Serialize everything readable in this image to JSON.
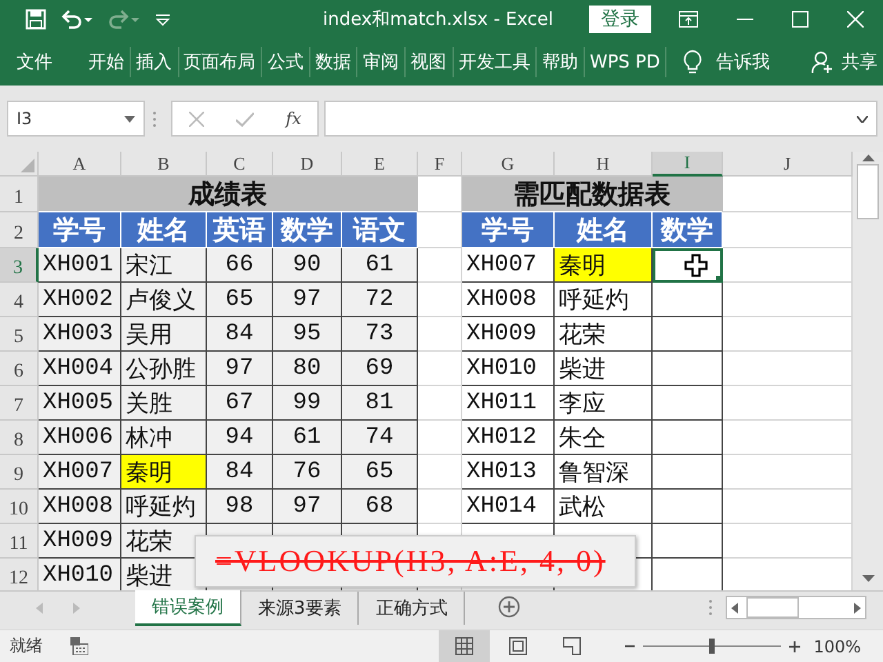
{
  "window": {
    "title": "index和match.xlsx  -  Excel",
    "login": "登录"
  },
  "ribbon": {
    "tabs": [
      "文件",
      "开始",
      "插入",
      "页面布局",
      "公式",
      "数据",
      "审阅",
      "视图",
      "开发工具",
      "帮助",
      "WPS PD"
    ],
    "tell_me": "告诉我",
    "share": "共享"
  },
  "formula_bar": {
    "name_box": "I3",
    "fx": "fx"
  },
  "sheet": {
    "columns": [
      {
        "label": "A",
        "selected": false
      },
      {
        "label": "B",
        "selected": false
      },
      {
        "label": "C",
        "selected": false
      },
      {
        "label": "D",
        "selected": false
      },
      {
        "label": "E",
        "selected": false
      },
      {
        "label": "F",
        "selected": false
      },
      {
        "label": "G",
        "selected": false
      },
      {
        "label": "H",
        "selected": false
      },
      {
        "label": "I",
        "selected": true
      },
      {
        "label": "J",
        "selected": false
      }
    ],
    "rows": [
      {
        "number": "1",
        "selected": false,
        "cells": [
          {
            "kind": "title"
          },
          {
            "kind": "title"
          },
          {
            "kind": "title",
            "text": "成绩表"
          },
          {
            "kind": "title"
          },
          {
            "kind": "title"
          },
          {
            "kind": "blank"
          },
          {
            "kind": "title"
          },
          {
            "kind": "title",
            "text": "需匹配数据表"
          },
          {
            "kind": "title"
          },
          {
            "kind": "blank"
          }
        ]
      },
      {
        "number": "2",
        "selected": false,
        "cells": [
          {
            "kind": "header",
            "text": "学号"
          },
          {
            "kind": "header",
            "text": "姓名"
          },
          {
            "kind": "header",
            "text": "英语"
          },
          {
            "kind": "header",
            "text": "数学"
          },
          {
            "kind": "header",
            "text": "语文"
          },
          {
            "kind": "blank"
          },
          {
            "kind": "header",
            "text": "学号"
          },
          {
            "kind": "header",
            "text": "姓名"
          },
          {
            "kind": "header",
            "text": "数学"
          },
          {
            "kind": "blank"
          }
        ]
      },
      {
        "number": "3",
        "selected": true,
        "cells": [
          {
            "kind": "text",
            "text": "XH001"
          },
          {
            "kind": "text",
            "text": "宋江"
          },
          {
            "kind": "number",
            "text": "66"
          },
          {
            "kind": "number",
            "text": "90"
          },
          {
            "kind": "number",
            "text": "61"
          },
          {
            "kind": "blank"
          },
          {
            "kind": "entry",
            "text": "XH007"
          },
          {
            "kind": "marked",
            "text": "秦明"
          },
          {
            "kind": "active"
          },
          {
            "kind": "blank"
          }
        ]
      },
      {
        "number": "4",
        "selected": false,
        "cells": [
          {
            "kind": "text",
            "text": "XH002"
          },
          {
            "kind": "text",
            "text": "卢俊义"
          },
          {
            "kind": "number",
            "text": "65"
          },
          {
            "kind": "number",
            "text": "97"
          },
          {
            "kind": "number",
            "text": "72"
          },
          {
            "kind": "blank"
          },
          {
            "kind": "entry",
            "text": "XH008"
          },
          {
            "kind": "entry",
            "text": "呼延灼"
          },
          {
            "kind": "entry"
          },
          {
            "kind": "blank"
          }
        ]
      },
      {
        "number": "5",
        "selected": false,
        "cells": [
          {
            "kind": "text",
            "text": "XH003"
          },
          {
            "kind": "text",
            "text": "吴用"
          },
          {
            "kind": "number",
            "text": "84"
          },
          {
            "kind": "number",
            "text": "95"
          },
          {
            "kind": "number",
            "text": "73"
          },
          {
            "kind": "blank"
          },
          {
            "kind": "entry",
            "text": "XH009"
          },
          {
            "kind": "entry",
            "text": "花荣"
          },
          {
            "kind": "entry"
          },
          {
            "kind": "blank"
          }
        ]
      },
      {
        "number": "6",
        "selected": false,
        "cells": [
          {
            "kind": "text",
            "text": "XH004"
          },
          {
            "kind": "text",
            "text": "公孙胜"
          },
          {
            "kind": "number",
            "text": "97"
          },
          {
            "kind": "number",
            "text": "80"
          },
          {
            "kind": "number",
            "text": "69"
          },
          {
            "kind": "blank"
          },
          {
            "kind": "entry",
            "text": "XH010"
          },
          {
            "kind": "entry",
            "text": "柴进"
          },
          {
            "kind": "entry"
          },
          {
            "kind": "blank"
          }
        ]
      },
      {
        "number": "7",
        "selected": false,
        "cells": [
          {
            "kind": "text",
            "text": "XH005"
          },
          {
            "kind": "text",
            "text": "关胜"
          },
          {
            "kind": "number",
            "text": "67"
          },
          {
            "kind": "number",
            "text": "99"
          },
          {
            "kind": "number",
            "text": "81"
          },
          {
            "kind": "blank"
          },
          {
            "kind": "entry",
            "text": "XH011"
          },
          {
            "kind": "entry",
            "text": "李应"
          },
          {
            "kind": "entry"
          },
          {
            "kind": "blank"
          }
        ]
      },
      {
        "number": "8",
        "selected": false,
        "cells": [
          {
            "kind": "text",
            "text": "XH006"
          },
          {
            "kind": "text",
            "text": "林冲"
          },
          {
            "kind": "number",
            "text": "94"
          },
          {
            "kind": "number",
            "text": "61"
          },
          {
            "kind": "number",
            "text": "74"
          },
          {
            "kind": "blank"
          },
          {
            "kind": "entry",
            "text": "XH012"
          },
          {
            "kind": "entry",
            "text": "朱仝"
          },
          {
            "kind": "entry"
          },
          {
            "kind": "blank"
          }
        ]
      },
      {
        "number": "9",
        "selected": false,
        "cells": [
          {
            "kind": "text",
            "text": "XH007"
          },
          {
            "kind": "marked",
            "text": "秦明"
          },
          {
            "kind": "number",
            "text": "84"
          },
          {
            "kind": "number",
            "text": "76"
          },
          {
            "kind": "number",
            "text": "65"
          },
          {
            "kind": "blank"
          },
          {
            "kind": "entry",
            "text": "XH013"
          },
          {
            "kind": "entry",
            "text": "鲁智深"
          },
          {
            "kind": "entry"
          },
          {
            "kind": "blank"
          }
        ]
      },
      {
        "number": "10",
        "selected": false,
        "cells": [
          {
            "kind": "text",
            "text": "XH008"
          },
          {
            "kind": "text",
            "text": "呼延灼"
          },
          {
            "kind": "number",
            "text": "98"
          },
          {
            "kind": "number",
            "text": "97"
          },
          {
            "kind": "number",
            "text": "68"
          },
          {
            "kind": "blank"
          },
          {
            "kind": "entry",
            "text": "XH014"
          },
          {
            "kind": "entry",
            "text": "武松"
          },
          {
            "kind": "entry"
          },
          {
            "kind": "blank"
          }
        ]
      },
      {
        "number": "11",
        "selected": false,
        "cells": [
          {
            "kind": "text",
            "text": "XH009"
          },
          {
            "kind": "text",
            "text": "花荣"
          },
          {
            "kind": "number"
          },
          {
            "kind": "number"
          },
          {
            "kind": "number"
          },
          {
            "kind": "blank"
          },
          {
            "kind": "entry"
          },
          {
            "kind": "entry"
          },
          {
            "kind": "entry"
          },
          {
            "kind": "blank"
          }
        ]
      },
      {
        "number": "12",
        "selected": false,
        "cells": [
          {
            "kind": "text",
            "text": "XH010"
          },
          {
            "kind": "text",
            "text": "柴进"
          },
          {
            "kind": "number"
          },
          {
            "kind": "number"
          },
          {
            "kind": "number"
          },
          {
            "kind": "blank"
          },
          {
            "kind": "entry"
          },
          {
            "kind": "entry"
          },
          {
            "kind": "entry"
          },
          {
            "kind": "blank"
          }
        ]
      }
    ]
  },
  "formula_note": {
    "text": "=VLOOKUP(H3, A:E, 4, 0)",
    "struck": true
  },
  "sheet_tabs": [
    {
      "label": "错误案例",
      "selected": true
    },
    {
      "label": "来源3要素",
      "selected": false
    },
    {
      "label": "正确方式",
      "selected": false
    }
  ],
  "status_bar": {
    "status": "就绪",
    "zoom": "100%",
    "zoom_level": {
      "level": 0.5
    }
  }
}
